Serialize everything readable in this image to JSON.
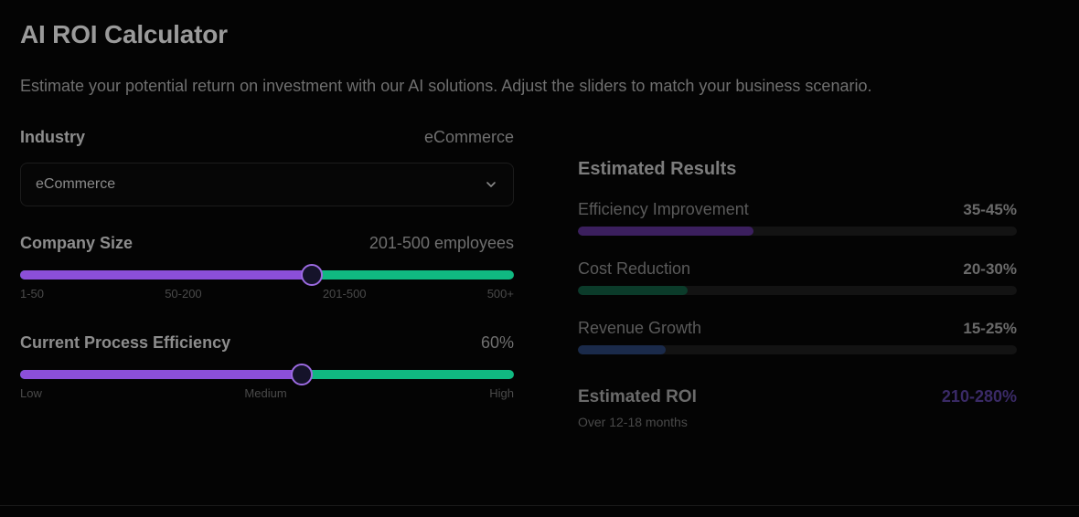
{
  "header": {
    "title": "AI ROI Calculator",
    "subtitle": "Estimate your potential return on investment with our AI solutions. Adjust the sliders to match your business scenario."
  },
  "industry": {
    "label": "Industry",
    "value": "eCommerce",
    "selected": "eCommerce",
    "icon": "chevron-down-icon"
  },
  "company_size": {
    "label": "Company Size",
    "value": "201-500 employees",
    "level": 0.59,
    "ticks": [
      "1-50",
      "50-200",
      "201-500",
      "500+"
    ]
  },
  "process_efficiency": {
    "label": "Current Process Efficiency",
    "value": "60%",
    "level": 0.57,
    "ticks": [
      "Low",
      "Medium",
      "High"
    ]
  },
  "results": {
    "title": "Estimated Results",
    "metrics": [
      {
        "label": "Efficiency Improvement",
        "value": "35-45%",
        "level": 0.4,
        "color": "#3b1f5e"
      },
      {
        "label": "Cost Reduction",
        "value": "20-30%",
        "level": 0.25,
        "color": "#0b3b2a"
      },
      {
        "label": "Revenue Growth",
        "value": "15-25%",
        "level": 0.2,
        "color": "#1a2a4a"
      }
    ],
    "roi_label": "Estimated ROI",
    "roi_value": "210-280%",
    "roi_note": "Over 12-18 months"
  },
  "colors": {
    "slider_fill": "#8b4fd8",
    "slider_track": "#10b981",
    "thumb_border": "#9b6ae0",
    "roi_value": "#3a2a66"
  }
}
